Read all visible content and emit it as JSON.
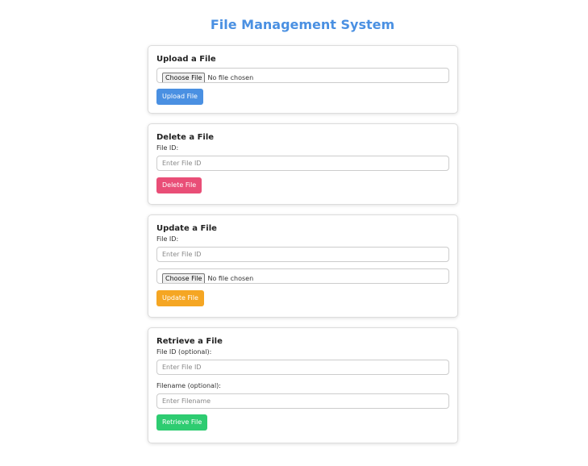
{
  "page": {
    "title": "File Management System"
  },
  "colors": {
    "title": "#4a90e2",
    "upload_button": "#4a90e2",
    "delete_button": "#e94e77",
    "update_button": "#f5a623",
    "retrieve_button": "#2ecc71"
  },
  "upload": {
    "heading": "Upload a File",
    "choose_label": "Choose File",
    "no_file_text": "No file chosen",
    "button_label": "Upload File"
  },
  "delete": {
    "heading": "Delete a File",
    "file_id_label": "File ID:",
    "file_id_placeholder": "Enter File ID",
    "button_label": "Delete File"
  },
  "update": {
    "heading": "Update a File",
    "file_id_label": "File ID:",
    "file_id_placeholder": "Enter File ID",
    "choose_label": "Choose File",
    "no_file_text": "No file chosen",
    "button_label": "Update File"
  },
  "retrieve": {
    "heading": "Retrieve a File",
    "file_id_label": "File ID (optional):",
    "file_id_placeholder": "Enter File ID",
    "filename_label": "Filename (optional):",
    "filename_placeholder": "Enter Filename",
    "button_label": "Retrieve File"
  }
}
